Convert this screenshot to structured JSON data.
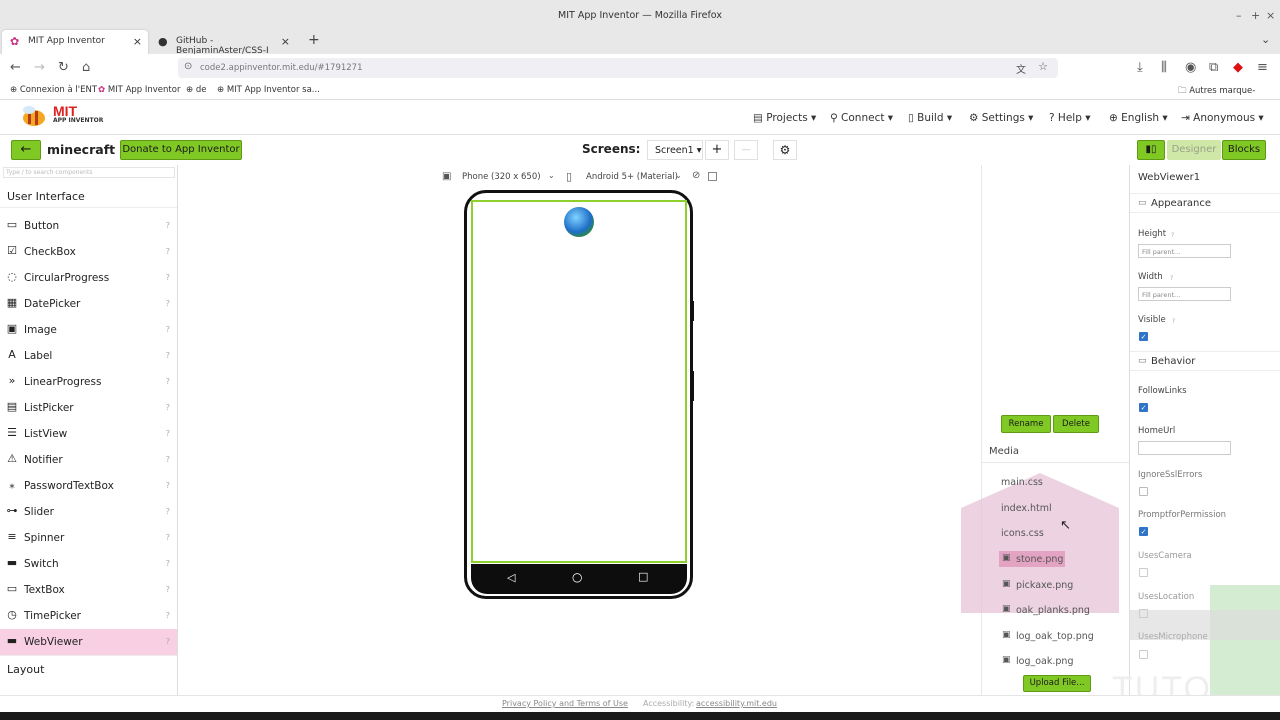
{
  "window": {
    "title": "MIT App Inventor — Mozilla Firefox"
  },
  "tabs": [
    {
      "label": "MIT App Inventor"
    },
    {
      "label": "GitHub - BenjaminAster/CSS-I"
    }
  ],
  "address_bar": {
    "url": "code2.appinventor.mit.edu/#1791271"
  },
  "bookmarks": [
    "Connexion à l'ENT",
    "MIT App Inventor",
    "de",
    "MIT App Inventor sa...",
    "Autres marque-pages"
  ],
  "app": {
    "logo_text": "MIT",
    "logo_sub": "APP INVENTOR",
    "menu": [
      "Projects ▾",
      "Connect ▾",
      "Build ▾",
      "Settings ▾",
      "Help ▾",
      "English ▾",
      "Anonymous ▾"
    ]
  },
  "toolbar": {
    "project_name": "minecraft",
    "donate_label": "Donate to App Inventor",
    "screens_label": "Screens:",
    "screen_select": "Screen1 ▾",
    "add": "+",
    "remove": "—",
    "designer_label": "Designer",
    "blocks_label": "Blocks"
  },
  "palette": {
    "search_placeholder": "Type / to search components",
    "section": "User Interface",
    "items": [
      "Button",
      "CheckBox",
      "CircularProgress",
      "DatePicker",
      "Image",
      "Label",
      "LinearProgress",
      "ListPicker",
      "ListView",
      "Notifier",
      "PasswordTextBox",
      "Slider",
      "Spinner",
      "Switch",
      "TextBox",
      "TimePicker",
      "WebViewer"
    ],
    "selected": "WebViewer",
    "next_section": "Layout"
  },
  "viewer": {
    "device_select": "Phone (320 x 650)",
    "theme_select": "Android 5+ (Material)"
  },
  "media": {
    "rename_label": "Rename",
    "delete_label": "Delete",
    "title": "Media",
    "files": [
      "main.css",
      "index.html",
      "icons.css",
      "stone.png",
      "pickaxe.png",
      "oak_planks.png",
      "log_oak_top.png",
      "log_oak.png"
    ],
    "upload_label": "Upload File..."
  },
  "properties": {
    "component": "WebViewer1",
    "appearance_label": "Appearance",
    "height_label": "Height",
    "height_value": "Fill parent...",
    "width_label": "Width",
    "width_value": "Fill parent...",
    "visible_label": "Visible",
    "behavior_label": "Behavior",
    "followlinks_label": "FollowLinks",
    "homeurl_label": "HomeUrl",
    "ignoressl_label": "IgnoreSslErrors",
    "prompt_label": "PromptforPermission",
    "camera_label": "UsesCamera",
    "location_label": "UsesLocation",
    "microphone_label": "UsesMicrophone"
  },
  "footer": {
    "privacy": "Privacy Policy and Terms of Use",
    "accessibility_label": "Accessibility:",
    "accessibility_link": "accessibility.mit.edu"
  },
  "watermark": {
    "text": "TUTO"
  },
  "colors": {
    "accent": "#80c924",
    "selected": "#f8cfe3",
    "checkbox": "#2f74c6"
  }
}
